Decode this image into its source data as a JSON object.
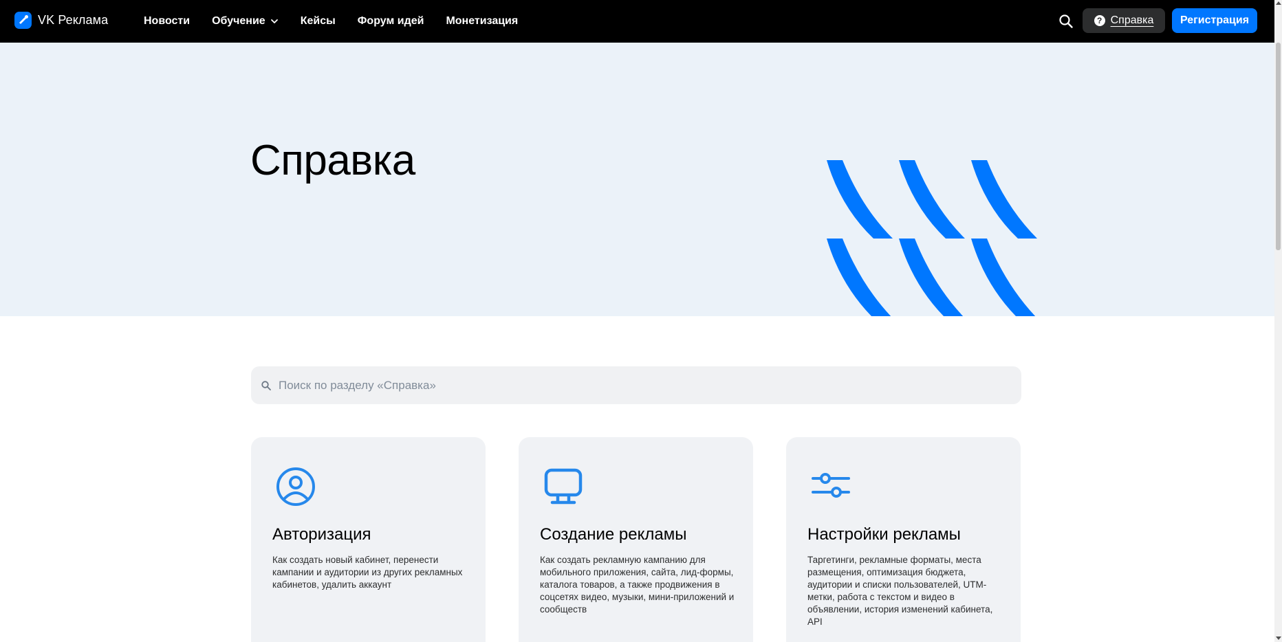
{
  "header": {
    "brand": "VK Реклама",
    "nav": [
      {
        "label": "Новости"
      },
      {
        "label": "Обучение",
        "has_dropdown": true
      },
      {
        "label": "Кейсы"
      },
      {
        "label": "Форум идей"
      },
      {
        "label": "Монетизация"
      }
    ],
    "help_label": "Справка",
    "register_label": "Регистрация"
  },
  "hero": {
    "title": "Справка"
  },
  "search": {
    "placeholder": "Поиск по разделу «Справка»"
  },
  "cards": [
    {
      "icon": "user-circle-icon",
      "title": "Авторизация",
      "description": "Как создать новый кабинет, перенести кампании и аудитории из других рекламных кабинетов, удалить аккаунт"
    },
    {
      "icon": "monitor-icon",
      "title": "Создание рекламы",
      "description": "Как создать рекламную кампанию для мобильного приложения, сайта, лид-формы, каталога товаров, а также продвижения в соцсетях видео, музыки, мини-приложений и сообществ"
    },
    {
      "icon": "sliders-icon",
      "title": "Настройки рекламы",
      "description": "Таргетинги, рекламные форматы, места размещения, оптимизация бюджета, аудитории и списки пользователей, UTM-метки, работа с текстом и видео в объявлении, история изменений кабинета, API"
    }
  ],
  "colors": {
    "accent": "#0077ff",
    "header_bg": "#000000",
    "hero_bg": "#ebf2f9",
    "card_bg": "#f0f2f5",
    "icon": "#2688eb"
  }
}
